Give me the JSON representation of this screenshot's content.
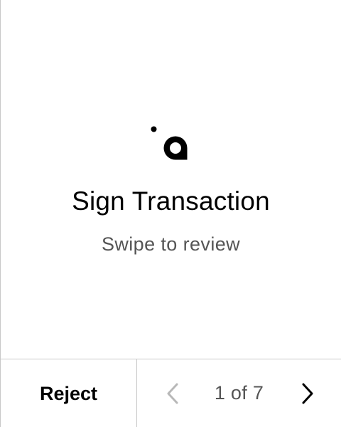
{
  "screen": {
    "title": "Sign Transaction",
    "subtitle": "Swipe to review"
  },
  "logo": {
    "icon": "app-logo-icon"
  },
  "footer": {
    "reject_label": "Reject",
    "page_counter": "1 of 7",
    "prev_icon": "chevron-left-icon",
    "next_icon": "chevron-right-icon"
  },
  "colors": {
    "text_primary": "#000000",
    "text_secondary": "#555555",
    "divider": "#c8c8c8",
    "disabled_icon": "#b8b8b8"
  }
}
